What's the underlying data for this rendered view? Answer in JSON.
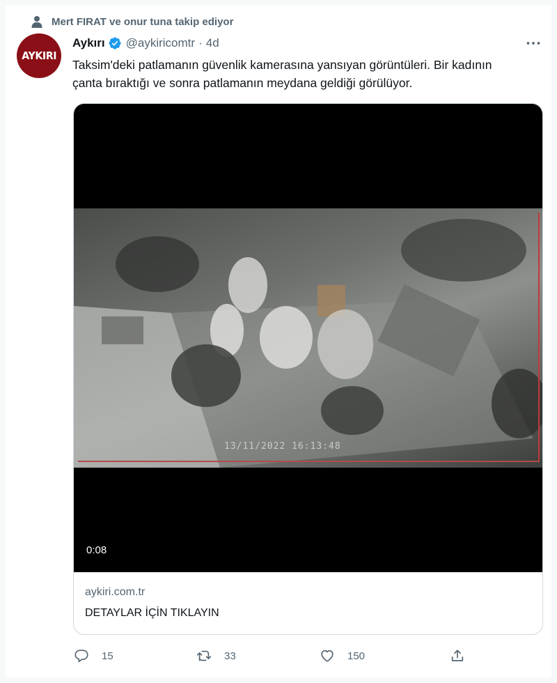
{
  "social_context": {
    "text": "Mert FIRAT ve onur tuna takip ediyor"
  },
  "author": {
    "avatar_text": "AYKIRI",
    "name": "Aykırı",
    "handle": "@aykiricomtr",
    "separator": "·",
    "time": "4d",
    "verified": true
  },
  "tweet": {
    "text": "Taksim'deki patlamanın güvenlik kamerasına yansıyan görüntüleri. Bir kadının çanta bıraktığı ve sonra patlamanın meydana geldiği görülüyor."
  },
  "media": {
    "overlay_timestamp": "13/11/2022 16:13:48",
    "duration": "0:08",
    "link_domain": "aykiri.com.tr",
    "link_title": "DETAYLAR İÇİN TIKLAYIN"
  },
  "actions": {
    "reply_count": "15",
    "retweet_count": "33",
    "like_count": "150"
  },
  "colors": {
    "secondary_text": "#536471",
    "verified_blue": "#1d9bf0",
    "avatar_red": "#8b0f16"
  },
  "icons": [
    "person-icon",
    "verified-icon",
    "more-icon",
    "reply-icon",
    "retweet-icon",
    "like-icon",
    "share-icon"
  ]
}
